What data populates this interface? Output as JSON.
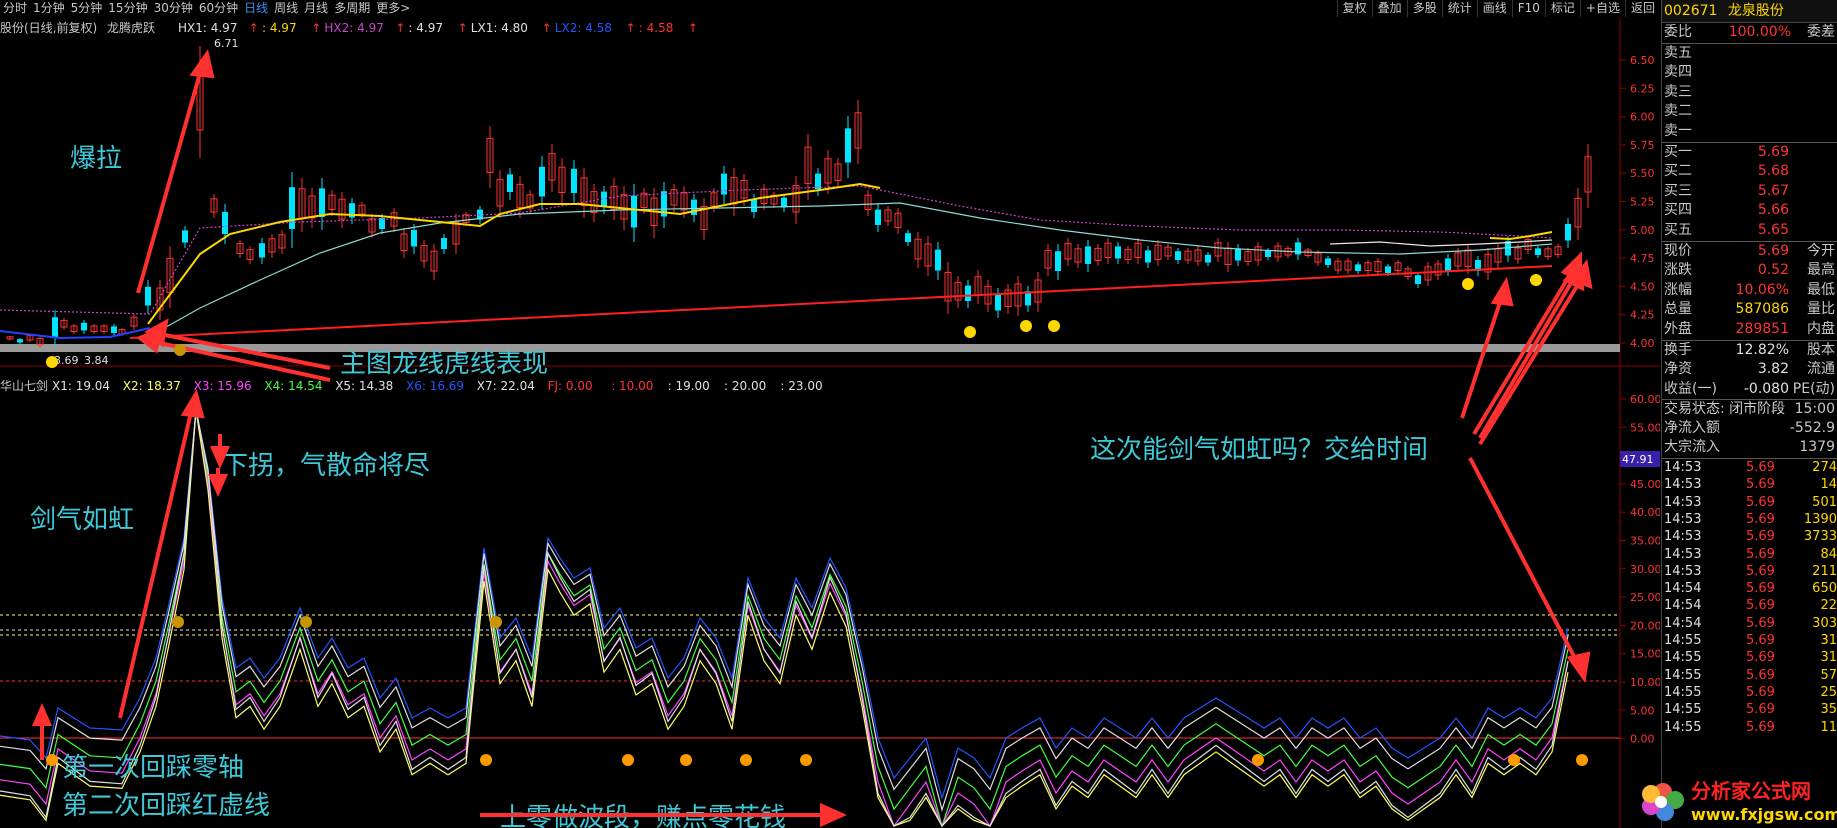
{
  "toolbar": {
    "periods": [
      "分时",
      "1分钟",
      "5分钟",
      "15分钟",
      "30分钟",
      "60分钟",
      "日线",
      "周线",
      "月线",
      "多周期",
      "更多>"
    ],
    "active_period": "日线",
    "right_buttons": [
      "复权",
      "叠加",
      "多股",
      "统计",
      "画线",
      "F10",
      "标记",
      "+自选",
      "返回"
    ]
  },
  "main_legend": {
    "prefix": "股份(日线,前复权)",
    "indicator": "龙腾虎跃",
    "items": [
      {
        "text": "HX1: 4.97",
        "color": "#e0e0e0"
      },
      {
        "text": "↑",
        "color": "#ff3333"
      },
      {
        "text": ": 4.97",
        "color": "#ffd700"
      },
      {
        "text": "↑",
        "color": "#ff3333"
      },
      {
        "text": "HX2: 4.97",
        "color": "#cc44cc"
      },
      {
        "text": "↑",
        "color": "#ff3333"
      },
      {
        "text": ": 4.97",
        "color": "#e0e0e0"
      },
      {
        "text": "↑",
        "color": "#ff3333"
      },
      {
        "text": "LX1: 4.80",
        "color": "#e0e0e0"
      },
      {
        "text": "↑",
        "color": "#ff3333"
      },
      {
        "text": "LX2: 4.58",
        "color": "#2255ff"
      },
      {
        "text": "↑",
        "color": "#ff3333"
      },
      {
        "text": ": 4.58",
        "color": "#ff3333"
      },
      {
        "text": "↑",
        "color": "#ff3333"
      }
    ]
  },
  "sub_legend": {
    "prefix": "华山七剑",
    "items": [
      {
        "text": "X1: 19.04",
        "color": "#e0e0e0"
      },
      {
        "text": "X2: 18.37",
        "color": "#ffff66"
      },
      {
        "text": "X3: 15.96",
        "color": "#ff44ff"
      },
      {
        "text": "X4: 14.54",
        "color": "#44ff44"
      },
      {
        "text": "X5: 14.38",
        "color": "#e0e0e0"
      },
      {
        "text": "X6: 16.69",
        "color": "#2255ff"
      },
      {
        "text": "X7: 22.04",
        "color": "#e0e0e0"
      },
      {
        "text": "FJ: 0.00",
        "color": "#ff3333"
      },
      {
        "text": ": 10.00",
        "color": "#ff3333"
      },
      {
        "text": ": 19.00",
        "color": "#e0e0e0"
      },
      {
        "text": ": 20.00",
        "color": "#e0e0e0"
      },
      {
        "text": ": 23.00",
        "color": "#e0e0e0"
      }
    ]
  },
  "price_axis": [
    "6.50",
    "6.25",
    "6.00",
    "5.75",
    "5.50",
    "5.25",
    "5.00",
    "4.75",
    "4.50",
    "4.25",
    "4.00"
  ],
  "osc_axis": [
    "60.00",
    "55.00",
    "50.00",
    "45.00",
    "40.00",
    "35.00",
    "30.00",
    "25.00",
    "20.00",
    "15.00",
    "10.00",
    "5.00",
    "0.00"
  ],
  "osc_current_label": "47.91",
  "price_labels": {
    "high": "6.71",
    "low": "3.69",
    "low2": "3.84"
  },
  "annotations": {
    "baola": "爆拉",
    "main_line": "主图龙线虎线表现",
    "xiaguai": "下拐，气散命将尽",
    "jianqi": "剑气如虹",
    "first_pullback": "第一次回踩零轴",
    "second_pullback": "第二次回踩红虚线",
    "wave": "上零做波段，赚点零花钱",
    "question": "这次能剑气如虹吗？交给时间"
  },
  "quote": {
    "code": "002671",
    "name": "龙泉股份",
    "weibi_label": "委比",
    "weibi_value": "100.00%",
    "weicha_label": "委差",
    "sell": [
      {
        "label": "卖五",
        "price": "",
        "vol": ""
      },
      {
        "label": "卖四",
        "price": "",
        "vol": ""
      },
      {
        "label": "卖三",
        "price": "",
        "vol": ""
      },
      {
        "label": "卖二",
        "price": "",
        "vol": ""
      },
      {
        "label": "卖一",
        "price": "",
        "vol": ""
      }
    ],
    "buy": [
      {
        "label": "买一",
        "price": "5.69"
      },
      {
        "label": "买二",
        "price": "5.68"
      },
      {
        "label": "买三",
        "price": "5.67"
      },
      {
        "label": "买四",
        "price": "5.66"
      },
      {
        "label": "买五",
        "price": "5.65"
      }
    ],
    "stats": [
      {
        "l1": "现价",
        "v1": "5.69",
        "c1": "red",
        "l2": "今开"
      },
      {
        "l1": "涨跌",
        "v1": "0.52",
        "c1": "red",
        "l2": "最高"
      },
      {
        "l1": "涨幅",
        "v1": "10.06%",
        "c1": "red",
        "l2": "最低"
      },
      {
        "l1": "总量",
        "v1": "587086",
        "c1": "yellow",
        "l2": "量比"
      },
      {
        "l1": "外盘",
        "v1": "289851",
        "c1": "red",
        "l2": "内盘"
      }
    ],
    "stats2": [
      {
        "l1": "换手",
        "v1": "12.82%",
        "c1": "white",
        "l2": "股本"
      },
      {
        "l1": "净资",
        "v1": "3.82",
        "c1": "white",
        "l2": "流通"
      },
      {
        "l1": "收益(一)",
        "v1": "-0.080",
        "c1": "white",
        "l2": "PE(动)"
      }
    ],
    "trade_state_label": "交易状态: 闭市阶段",
    "trade_state_time": "15:00",
    "net_inflow_label": "净流入额",
    "net_inflow_value": "-552.9",
    "block_label": "大宗流入",
    "block_value": "1379",
    "ticks": [
      {
        "t": "14:53",
        "p": "5.69",
        "v": "274"
      },
      {
        "t": "14:53",
        "p": "5.69",
        "v": "14"
      },
      {
        "t": "14:53",
        "p": "5.69",
        "v": "501"
      },
      {
        "t": "14:53",
        "p": "5.69",
        "v": "1390"
      },
      {
        "t": "14:53",
        "p": "5.69",
        "v": "3733"
      },
      {
        "t": "14:53",
        "p": "5.69",
        "v": "84"
      },
      {
        "t": "14:53",
        "p": "5.69",
        "v": "211"
      },
      {
        "t": "14:54",
        "p": "5.69",
        "v": "650"
      },
      {
        "t": "14:54",
        "p": "5.69",
        "v": "22"
      },
      {
        "t": "14:54",
        "p": "5.69",
        "v": "303"
      },
      {
        "t": "14:55",
        "p": "5.69",
        "v": "31"
      },
      {
        "t": "14:55",
        "p": "5.69",
        "v": "31"
      },
      {
        "t": "14:55",
        "p": "5.69",
        "v": "57"
      },
      {
        "t": "14:55",
        "p": "5.69",
        "v": "25"
      },
      {
        "t": "14:55",
        "p": "5.69",
        "v": "35"
      },
      {
        "t": "14:55",
        "p": "5.69",
        "v": "11"
      }
    ]
  },
  "watermark": {
    "title": "分析家公式网",
    "url": "www.fxjgsw.com"
  },
  "colors": {
    "up": "#ff3333",
    "down": "#00e5ff",
    "annotation": "#3ec8d8",
    "arrow": "#ff3333"
  }
}
